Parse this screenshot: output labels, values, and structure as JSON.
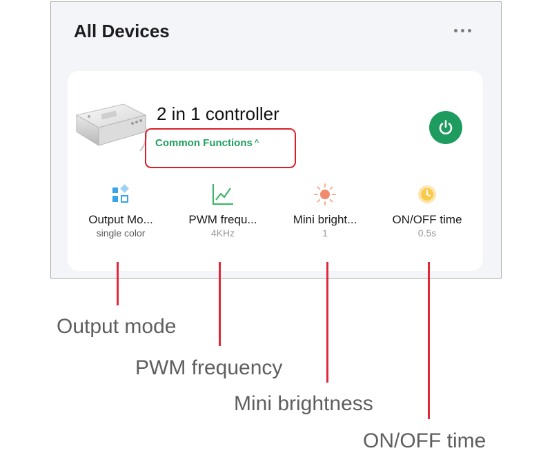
{
  "header": {
    "title": "All Devices",
    "more_icon": "more-horizontal-icon"
  },
  "device": {
    "name": "2 in 1 controller",
    "common_functions_label": "Common Functions",
    "expand_icon": "caret-up-icon",
    "power_icon": "power-icon",
    "accent_color": "#1e9b5e",
    "highlight_color": "#d81f2a"
  },
  "functions": [
    {
      "icon": "grid-blocks-icon",
      "label": "Output Mo...",
      "value": "single color"
    },
    {
      "icon": "line-chart-icon",
      "label": "PWM frequ...",
      "value": "4KHz"
    },
    {
      "icon": "sun-icon",
      "label": "Mini bright...",
      "value": "1"
    },
    {
      "icon": "clock-icon",
      "label": "ON/OFF time",
      "value": "0.5s"
    }
  ],
  "callouts": [
    "Output mode",
    "PWM frequency",
    "Mini brightness",
    "ON/OFF time"
  ]
}
